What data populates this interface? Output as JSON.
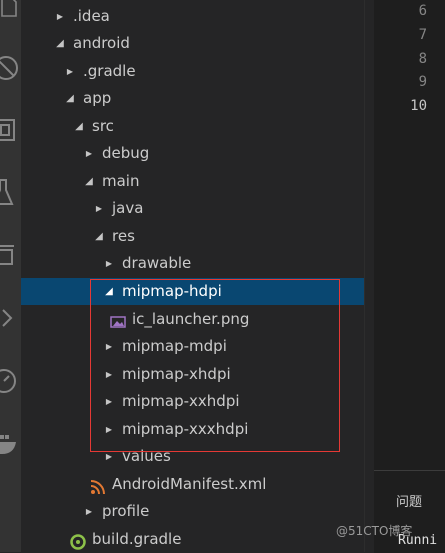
{
  "activity_bar": {
    "icons": [
      "explorer-icon",
      "extensions-blocked-icon",
      "extensions-icon",
      "flask-icon",
      "cards-icon",
      "chevron-right-icon",
      "timer-icon",
      "docker-icon"
    ]
  },
  "tree": {
    "items": [
      {
        "label": ".idea",
        "state": "collapsed",
        "icon": "none"
      },
      {
        "label": "android",
        "state": "expanded",
        "icon": "none"
      },
      {
        "label": ".gradle",
        "state": "collapsed",
        "icon": "none"
      },
      {
        "label": "app",
        "state": "expanded",
        "icon": "none"
      },
      {
        "label": "src",
        "state": "expanded",
        "icon": "none"
      },
      {
        "label": "debug",
        "state": "collapsed",
        "icon": "none"
      },
      {
        "label": "main",
        "state": "expanded",
        "icon": "none"
      },
      {
        "label": "java",
        "state": "collapsed",
        "icon": "none"
      },
      {
        "label": "res",
        "state": "expanded",
        "icon": "none"
      },
      {
        "label": "drawable",
        "state": "collapsed",
        "icon": "none"
      },
      {
        "label": "mipmap-hdpi",
        "state": "expanded",
        "icon": "none",
        "selected": true
      },
      {
        "label": "ic_launcher.png",
        "state": "file",
        "icon": "image-file-icon"
      },
      {
        "label": "mipmap-mdpi",
        "state": "collapsed",
        "icon": "none"
      },
      {
        "label": "mipmap-xhdpi",
        "state": "collapsed",
        "icon": "none"
      },
      {
        "label": "mipmap-xxhdpi",
        "state": "collapsed",
        "icon": "none"
      },
      {
        "label": "mipmap-xxxhdpi",
        "state": "collapsed",
        "icon": "none"
      },
      {
        "label": "values",
        "state": "collapsed",
        "icon": "none"
      },
      {
        "label": "AndroidManifest.xml",
        "state": "file",
        "icon": "rss-xml-icon"
      },
      {
        "label": "profile",
        "state": "collapsed",
        "icon": "none"
      },
      {
        "label": "build.gradle",
        "state": "file",
        "icon": "gradle-icon"
      }
    ]
  },
  "editor": {
    "line_numbers": [
      "6",
      "7",
      "8",
      "9",
      "10"
    ],
    "active_line": "10"
  },
  "panel": {
    "tab_label": "问题",
    "output_text": "Runni"
  },
  "watermark": "@51CTO博客",
  "colors": {
    "sidebar_bg": "#252526",
    "activity_bar_bg": "#333333",
    "selection_bg": "#094771",
    "highlight_border": "#e53935"
  }
}
